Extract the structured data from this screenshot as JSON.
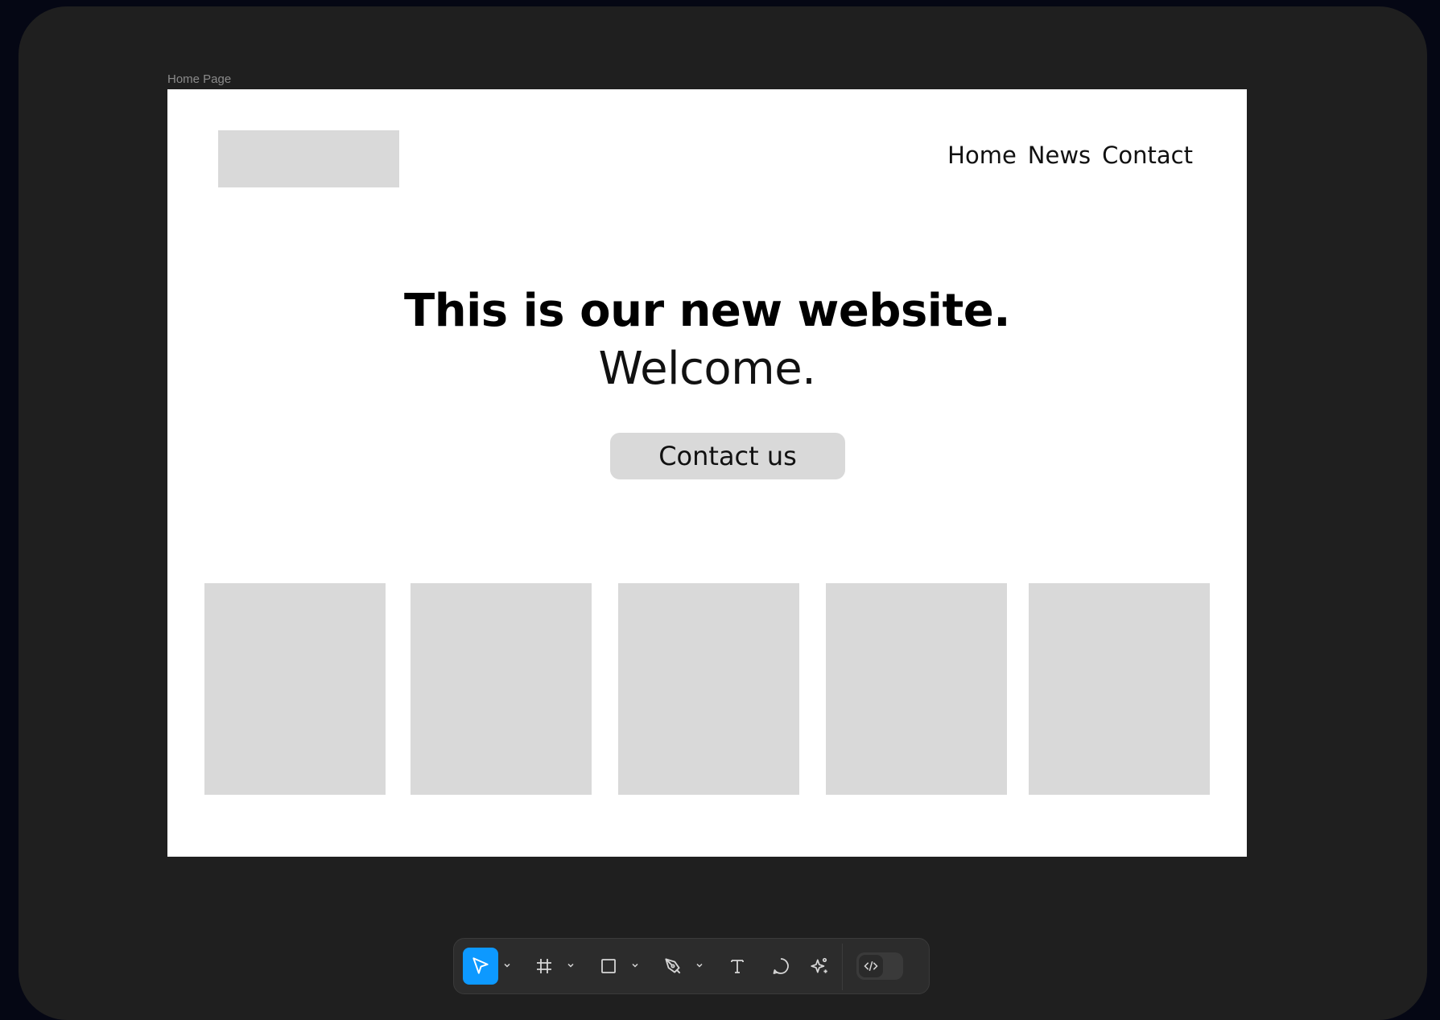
{
  "canvas": {
    "frame_label": "Home Page"
  },
  "frame": {
    "nav": {
      "items": [
        "Home",
        "News",
        "Contact"
      ]
    },
    "hero": {
      "title": "This is our new website.",
      "subtitle": "Welcome.",
      "cta_label": "Contact us"
    }
  },
  "toolbar": {
    "tools": [
      {
        "icon": "move-pointer-icon",
        "active": true
      },
      {
        "icon": "frame-hash-icon",
        "active": false
      },
      {
        "icon": "rectangle-icon",
        "active": false
      },
      {
        "icon": "pen-icon",
        "active": false
      },
      {
        "icon": "text-icon",
        "active": false
      },
      {
        "icon": "comment-icon",
        "active": false
      },
      {
        "icon": "actions-sparkle-icon",
        "active": false
      }
    ],
    "dev_mode_toggle": {
      "icon": "code-icon",
      "on": false
    },
    "accent_color": "#0d99ff"
  }
}
